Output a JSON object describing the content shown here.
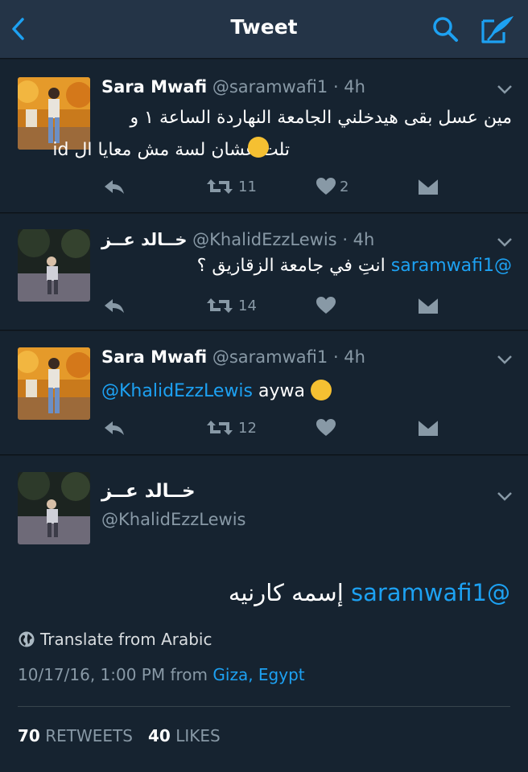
{
  "header": {
    "title": "Tweet",
    "back_icon": "chevron-left-icon",
    "search_icon": "search-icon",
    "compose_icon": "compose-icon",
    "accent": "#1da1f2"
  },
  "tweets": [
    {
      "display_name": "Sara Mwafi",
      "handle": "@saramwafi1",
      "time": "· 4h",
      "text_line1": "مين عسل بقى هيدخلني الجامعة النهاردة الساعة ١ و",
      "text_line2": "تلت عشان لسة مش معايا ال id",
      "retweets": "11",
      "likes": "2"
    },
    {
      "display_name": "خــالد عــز",
      "handle": "@KhalidEzzLewis",
      "time": "· 4h",
      "mention": "@saramwafi1",
      "text": "انتِ في جامعة الزقازيق ؟",
      "retweets": "14",
      "likes": ""
    },
    {
      "display_name": "Sara Mwafi",
      "handle": "@saramwafi1",
      "time": "· 4h",
      "mention": "@KhalidEzzLewis",
      "text": "aywa",
      "retweets": "12",
      "likes": ""
    }
  ],
  "detail": {
    "display_name": "خــالد عــز",
    "handle": "@KhalidEzzLewis",
    "mention": "@saramwafi1",
    "text": "إسمه كارنيه",
    "translate": "Translate from Arabic",
    "timestamp": "10/17/16, 1:00 PM from",
    "location": "Giza, Egypt",
    "retweets_count": "70",
    "retweets_label": "RETWEETS",
    "likes_count": "40",
    "likes_label": "LIKES"
  }
}
